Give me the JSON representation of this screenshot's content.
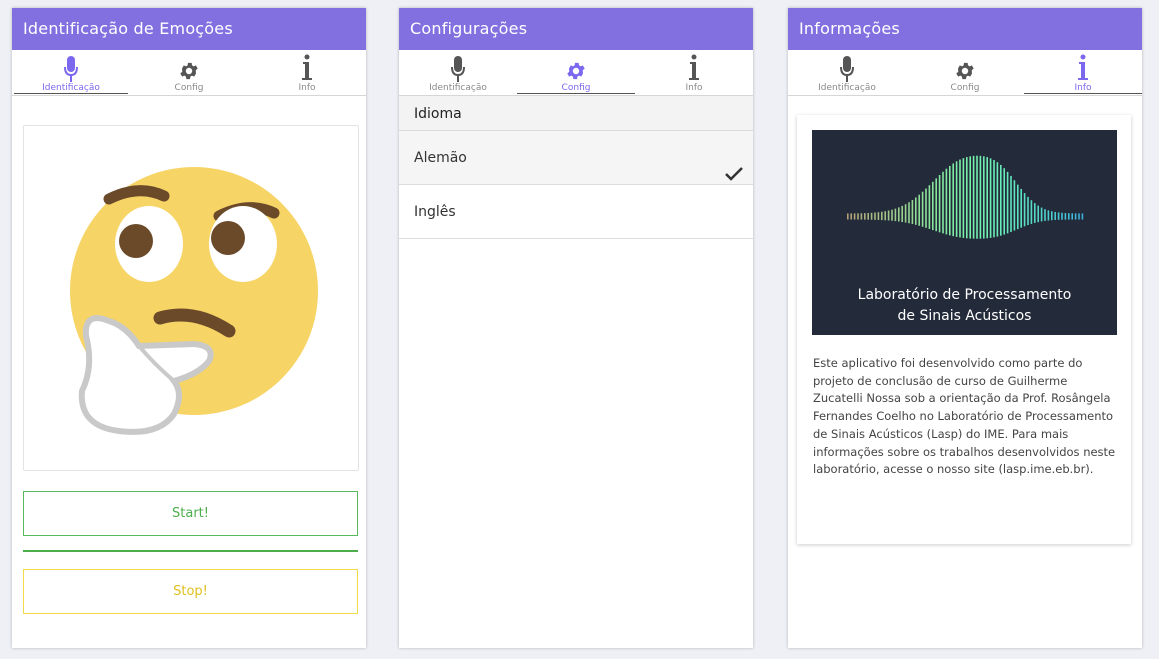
{
  "tabs": {
    "identification": "Identificação",
    "config": "Config",
    "info": "Info"
  },
  "screen1": {
    "title": "Identificação de Emoções",
    "start_label": "Start!",
    "stop_label": "Stop!",
    "emoji": "thinking-face"
  },
  "screen2": {
    "title": "Configurações",
    "section_header": "Idioma",
    "options": [
      {
        "label": "Alemão",
        "selected": true
      },
      {
        "label": "Inglês",
        "selected": false
      }
    ]
  },
  "screen3": {
    "title": "Informações",
    "image_text_line1": "Laboratório de Processamento",
    "image_text_line2": "de Sinais Acústicos",
    "description": "Este aplicativo foi desenvolvido como parte do projeto de conclusão de curso de Guilherme Zucatelli Nossa sob a orientação da Prof. Rosângela Fernandes Coelho no Laboratório de Processamento de Sinais Acústicos (Lasp) do IME. Para mais informações sobre os trabalhos desenvolvidos neste laboratório, acesse o nosso site (lasp.ime.eb.br)."
  },
  "colors": {
    "header": "#8370e0",
    "active_tab": "#7b68ee",
    "start": "#5cb85c",
    "stop": "#f0d94a"
  }
}
